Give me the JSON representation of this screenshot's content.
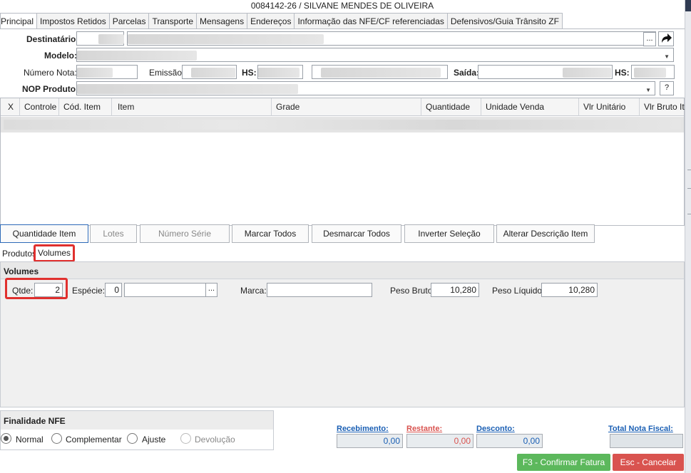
{
  "window": {
    "title": "0084142-26 / SILVANE MENDES DE OLIVEIRA"
  },
  "tabs": [
    {
      "label": "Principal",
      "active": true
    },
    {
      "label": "Impostos Retidos"
    },
    {
      "label": "Parcelas"
    },
    {
      "label": "Transporte"
    },
    {
      "label": "Mensagens"
    },
    {
      "label": "Endereços"
    },
    {
      "label": "Informação das NFE/CF referenciadas"
    },
    {
      "label": "Defensivos/Guia Trânsito ZF"
    }
  ],
  "form": {
    "destinatario_label": "Destinatário:",
    "modelo_label": "Modelo:",
    "numero_nota_label": "Número Nota:",
    "emissao_label": "Emissão:",
    "hs_label": "HS:",
    "saida_label": "Saída:",
    "hs2_label": "HS:",
    "nop_label": "NOP Produto:",
    "ellipsis": "...",
    "help": "?"
  },
  "grid": {
    "columns": [
      "X",
      "Controle",
      "Cód. Item",
      "Item",
      "Grade",
      "Quantidade",
      "Unidade Venda",
      "Vlr Unitário",
      "Vlr Bruto Ite"
    ]
  },
  "actions": [
    {
      "label": "Quantidade Item",
      "enabled": true
    },
    {
      "label": "Lotes",
      "enabled": false
    },
    {
      "label": "Número Série",
      "enabled": false
    },
    {
      "label": "Marcar Todos",
      "enabled": true
    },
    {
      "label": "Desmarcar Todos",
      "enabled": true
    },
    {
      "label": "Inverter Seleção",
      "enabled": true
    },
    {
      "label": "Alterar Descrição Item",
      "enabled": true
    }
  ],
  "subtabs": [
    {
      "label": "Produtos"
    },
    {
      "label": "Volumes",
      "active": true
    }
  ],
  "volumes": {
    "section_title": "Volumes",
    "qtde_label": "Qtde:",
    "qtde_value": "2",
    "especie_label": "Espécie:",
    "especie_value": "0",
    "especie_desc": "",
    "marca_label": "Marca:",
    "marca_value": "",
    "peso_bruto_label": "Peso Bruto:",
    "peso_bruto_value": "10,280",
    "peso_liquido_label": "Peso Líquido:",
    "peso_liquido_value": "10,280"
  },
  "finalidade": {
    "title": "Finalidade NFE",
    "options": [
      {
        "label": "Normal",
        "selected": true
      },
      {
        "label": "Complementar"
      },
      {
        "label": "Ajuste"
      },
      {
        "label": "Devolução",
        "disabled": true
      }
    ]
  },
  "totals": {
    "recebimento_label": "Recebimento:",
    "recebimento_value": "0,00",
    "restante_label": "Restante:",
    "restante_value": "0,00",
    "desconto_label": "Desconto:",
    "desconto_value": "0,00",
    "total_label": "Total Nota Fiscal:",
    "total_value": ""
  },
  "buttons": {
    "confirm": "F3 - Confirmar Fatura",
    "cancel": "Esc - Cancelar"
  },
  "colors": {
    "link_blue": "#1a5fb4",
    "restante_red": "#d9534f",
    "confirm_green": "#5cb85c",
    "cancel_red": "#d9534f",
    "highlight_red": "#e0302e"
  }
}
